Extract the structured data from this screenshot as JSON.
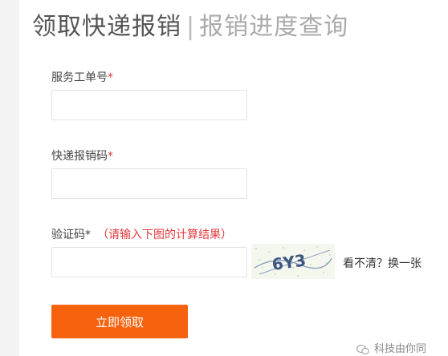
{
  "header": {
    "active_tab": "领取快递报销",
    "separator": "|",
    "other_tab": "报销进度查询"
  },
  "form": {
    "service_order": {
      "label": "服务工单号",
      "required": "*",
      "value": "",
      "placeholder": ""
    },
    "express_code": {
      "label": "快递报销码",
      "required": "*",
      "value": "",
      "placeholder": ""
    },
    "captcha": {
      "label": "验证码",
      "required": "*",
      "hint": "（请输入下图的计算结果）",
      "value": "",
      "placeholder": "",
      "image_text": "6Y3",
      "refresh_text": "看不清？换一张"
    },
    "submit_label": "立即领取"
  },
  "watermark": {
    "text": "科技由你同",
    "icon": "wechat-icon"
  },
  "colors": {
    "accent": "#f7620f",
    "required": "#e4393c"
  }
}
